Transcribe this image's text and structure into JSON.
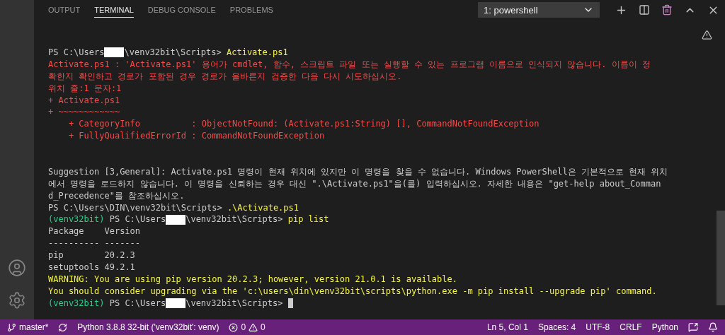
{
  "tabs": [
    {
      "label": "OUTPUT",
      "selected": false
    },
    {
      "label": "TERMINAL",
      "selected": true
    },
    {
      "label": "DEBUG CONSOLE",
      "selected": false
    },
    {
      "label": "PROBLEMS",
      "selected": false
    }
  ],
  "terminal_picker": {
    "value": "1: powershell"
  },
  "terminal_lines": [
    {
      "kind": "text",
      "segments": [
        {
          "text": "PS C:\\Users"
        },
        {
          "redacted": true
        },
        {
          "text": "\\venv32bit\\Scripts> "
        },
        {
          "text": "Activate.ps1",
          "color": "#f5f543"
        }
      ]
    },
    {
      "kind": "text",
      "segments": [
        {
          "text": "Activate.ps1 : 'Activate.ps1' 용어가 cmdlet, 함수, 스크립트 파일 또는 실행할 수 있는 프로그램 이름으로 인식되지 않습니다. 이름이 정",
          "color": "#f14c4c"
        }
      ]
    },
    {
      "kind": "text",
      "segments": [
        {
          "text": "확한지 확인하고 경로가 포함된 경우 경로가 올바른지 검증한 다음 다시 시도하십시오.",
          "color": "#f14c4c"
        }
      ]
    },
    {
      "kind": "text",
      "segments": [
        {
          "text": "위치 줄:1 문자:1",
          "color": "#f14c4c"
        }
      ]
    },
    {
      "kind": "text",
      "segments": [
        {
          "text": "+ Activate.ps1",
          "color": "#f14c4c"
        }
      ]
    },
    {
      "kind": "text",
      "segments": [
        {
          "text": "+ ~~~~~~~~~~~~",
          "color": "#f14c4c"
        }
      ]
    },
    {
      "kind": "text",
      "segments": [
        {
          "text": "    + CategoryInfo          : ObjectNotFound: (Activate.ps1:String) [], CommandNotFoundException",
          "color": "#f14c4c"
        }
      ]
    },
    {
      "kind": "text",
      "segments": [
        {
          "text": "    + FullyQualifiedErrorId : CommandNotFoundException",
          "color": "#f14c4c"
        }
      ]
    },
    {
      "kind": "blank"
    },
    {
      "kind": "blank"
    },
    {
      "kind": "text",
      "segments": [
        {
          "text": "Suggestion [3,General]: Activate.ps1 명령이 현재 위치에 있지만 이 명령을 찾을 수 없습니다. Windows PowerShell은 기본적으로 현재 위치"
        }
      ]
    },
    {
      "kind": "text",
      "segments": [
        {
          "text": "에서 명령을 로드하지 않습니다. 이 명령을 신뢰하는 경우 대신 \".\\Activate.ps1\"을(를) 입력하십시오. 자세한 내용은 \"get-help about_Comman"
        }
      ]
    },
    {
      "kind": "text",
      "segments": [
        {
          "text": "d_Precedence\"를 참조하십시오."
        }
      ]
    },
    {
      "kind": "text",
      "segments": [
        {
          "text": "PS C:\\Users\\DIN\\venv32bit\\Scripts> "
        },
        {
          "text": ".\\Activate.ps1",
          "color": "#f5f543"
        }
      ]
    },
    {
      "kind": "text",
      "segments": [
        {
          "text": "(venv32bit) ",
          "color": "#23d18b"
        },
        {
          "text": "PS C:\\Users"
        },
        {
          "redacted": true
        },
        {
          "text": "\\venv32bit\\Scripts> "
        },
        {
          "text": "pip list",
          "color": "#f5f543"
        }
      ]
    },
    {
      "kind": "text",
      "segments": [
        {
          "text": "Package    Version"
        }
      ]
    },
    {
      "kind": "text",
      "segments": [
        {
          "text": "---------- -------"
        }
      ]
    },
    {
      "kind": "text",
      "segments": [
        {
          "text": "pip        20.2.3"
        }
      ]
    },
    {
      "kind": "text",
      "segments": [
        {
          "text": "setuptools 49.2.1"
        }
      ]
    },
    {
      "kind": "text",
      "segments": [
        {
          "text": "WARNING: You are using pip version 20.2.3; however, version 21.0.1 is available.",
          "color": "#f5f543"
        }
      ]
    },
    {
      "kind": "text",
      "segments": [
        {
          "text": "You should consider upgrading via the 'c:\\users\\din\\venv32bit\\scripts\\python.exe -m pip install --upgrade pip' command.",
          "color": "#f5f543"
        }
      ]
    },
    {
      "kind": "text",
      "segments": [
        {
          "text": "(venv32bit) ",
          "color": "#23d18b"
        },
        {
          "text": "PS C:\\Users"
        },
        {
          "redacted": true
        },
        {
          "text": "\\venv32bit\\Scripts> "
        },
        {
          "cursor": true
        }
      ]
    }
  ],
  "status_bar": {
    "branch": "master*",
    "interpreter": "Python 3.8.8 32-bit ('venv32bit': venv)",
    "errors": "0",
    "warnings": "0",
    "position": "Ln 5, Col 1",
    "indent": "Spaces: 4",
    "encoding": "UTF-8",
    "line_ending": "CRLF",
    "language": "Python"
  }
}
